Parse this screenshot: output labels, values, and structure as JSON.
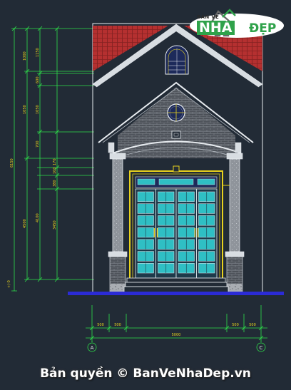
{
  "logo": {
    "top_text": "BẢN VẼ",
    "nha_text": "NHÀ",
    "dep_text": "ĐẸP"
  },
  "watermark": "Bản quyền © BanVeNhaDep.vn",
  "dimensions": {
    "left_outer": [
      "1000",
      "1050",
      "4500",
      "6150",
      "+/-0"
    ],
    "left_inner_top": [
      "1150",
      "600",
      "1050",
      "700"
    ],
    "left_inner_mid": [
      "170",
      "100",
      "380"
    ],
    "left_inner_low": [
      "4100",
      "3450"
    ],
    "bottom_row1": [
      "500",
      "500",
      "500",
      "500"
    ],
    "bottom_total": "5000",
    "grid_labels": [
      "A",
      "C"
    ]
  },
  "colors": {
    "background": "#222b36",
    "roof": "#c23636",
    "brick": "#5a5f66",
    "door": "#2fbfc4",
    "yellow": "#e8d21d",
    "ground": "#2b2bd6",
    "dim_green": "#2ee04a",
    "line": "#e8ecf0"
  }
}
